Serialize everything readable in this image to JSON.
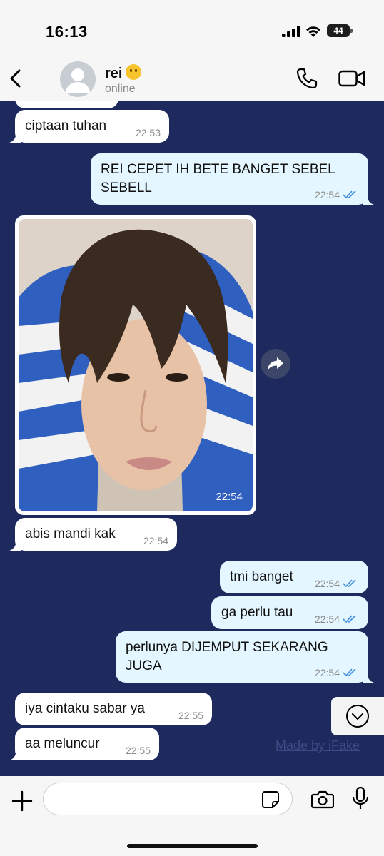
{
  "status_bar": {
    "time": "16:13",
    "battery": "44",
    "icons": [
      "signal-icon",
      "wifi-icon",
      "battery-icon"
    ]
  },
  "header": {
    "contact_name": "rei",
    "contact_emoji": "raised-eyebrow-face-emoji",
    "contact_status": "online",
    "icons": [
      "back-chevron-icon",
      "avatar-placeholder-icon",
      "phone-icon",
      "video-camera-icon"
    ]
  },
  "messages": [
    {
      "direction": "in",
      "text": "ciptaan tuhan",
      "time": "22:53"
    },
    {
      "direction": "out",
      "text": "REI CEPET IH BETE BANGET SEBEL SEBELL",
      "time": "22:54",
      "read": true
    },
    {
      "direction": "in",
      "type": "photo",
      "time": "22:54"
    },
    {
      "direction": "in",
      "text": "abis mandi kak",
      "time": "22:54"
    },
    {
      "direction": "out",
      "text": "tmi banget",
      "time": "22:54",
      "read": true
    },
    {
      "direction": "out",
      "text": "ga perlu tau",
      "time": "22:54",
      "read": true
    },
    {
      "direction": "out",
      "text": "perlunya DIJEMPUT SEKARANG JUGA",
      "time": "22:54",
      "read": true
    },
    {
      "direction": "in",
      "text": "iya cintaku sabar ya",
      "time": "22:55"
    },
    {
      "direction": "in",
      "text": "aa meluncur",
      "time": "22:55"
    }
  ],
  "watermark": "Made by iFake",
  "input_bar": {
    "placeholder": "",
    "icons": [
      "plus-icon",
      "sticker-icon",
      "camera-icon",
      "microphone-icon"
    ]
  },
  "colors": {
    "chat_background": "#1e2a5e",
    "incoming_bubble": "#ffffff",
    "outgoing_bubble": "#e4f6ff",
    "read_ticks": "#3d8de0"
  }
}
